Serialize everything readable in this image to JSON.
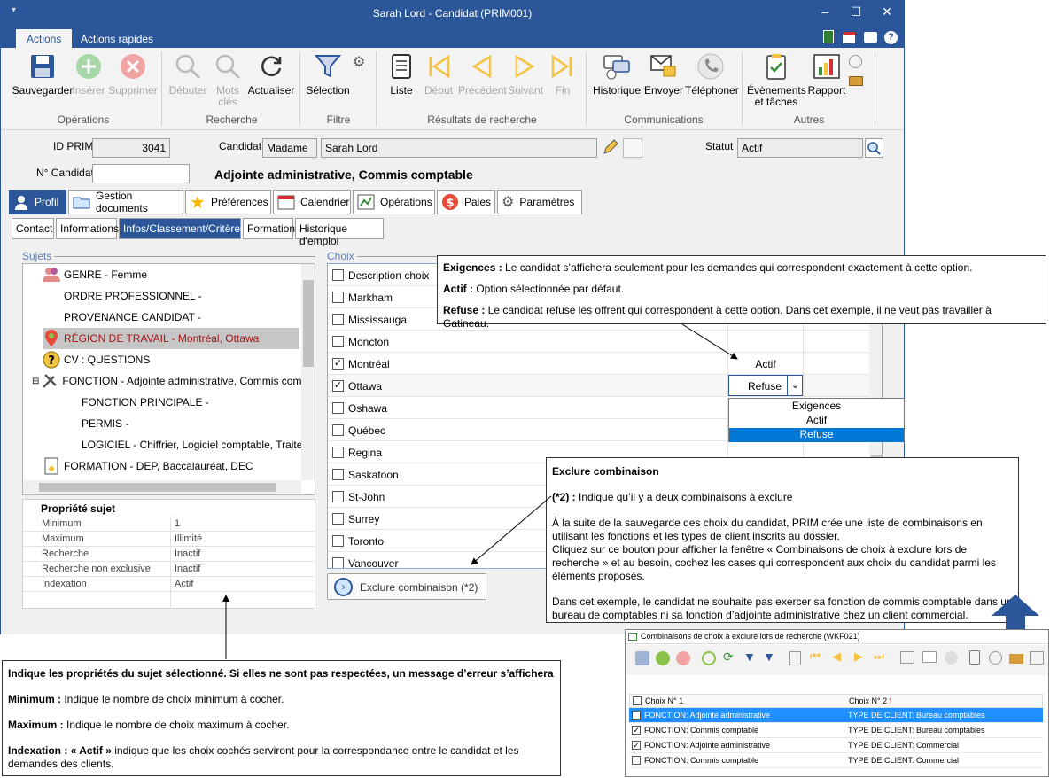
{
  "window": {
    "title": "Sarah Lord - Candidat (PRIM001)",
    "minimize": "–",
    "maximize": "☐",
    "close": "✕"
  },
  "ribbon_tabs": [
    "Actions",
    "Actions rapides"
  ],
  "ribbon": {
    "buttons": {
      "sauvegarder": "Sauvegarder",
      "inserer": "Insérer",
      "supprimer": "Supprimer",
      "debuter": "Débuter",
      "mots_cles": "Mots clés",
      "actualiser": "Actualiser",
      "selection": "Sélection",
      "liste": "Liste",
      "debut": "Début",
      "precedent": "Précédent",
      "suivant": "Suivant",
      "fin": "Fin",
      "historique": "Historique",
      "envoyer": "Envoyer",
      "telephoner": "Téléphoner",
      "evenements": "Évènements et tâches",
      "rapport": "Rapport"
    },
    "groups": [
      "Opérations",
      "Recherche",
      "Filtre",
      "Résultats de recherche",
      "Communications",
      "Autres"
    ]
  },
  "header": {
    "id_prim_label": "ID PRIM",
    "id_prim_value": "3041",
    "candidat_label": "Candidat",
    "civilite": "Madame",
    "nom": "Sarah Lord",
    "statut_label": "Statut",
    "statut_value": "Actif",
    "no_candidat_label": "N° Candidat",
    "no_candidat_value": "",
    "poste": "Adjointe administrative, Commis comptable"
  },
  "main_tabs": [
    "Profil",
    "Gestion documents",
    "Préférences",
    "Calendrier",
    "Opérations",
    "Paies",
    "Paramètres"
  ],
  "sub_tabs": [
    "Contact",
    "Informations",
    "Infos/Classement/Critères",
    "Formation",
    "Historique d'emploi"
  ],
  "sujets": {
    "legend": "Sujets",
    "items": [
      "GENRE - Femme",
      "ORDRE PROFESSIONNEL -",
      "PROVENANCE CANDIDAT -",
      "RÉGION DE TRAVAIL - Montréal, Ottawa",
      "CV : QUESTIONS",
      "FONCTION - Adjointe administrative, Commis comptable",
      "FONCTION PRINCIPALE -",
      "PERMIS -",
      "LOGICIEL - Chiffrier, Logiciel comptable, Traitement",
      "FORMATION - DEP, Baccalauréat, DEC"
    ]
  },
  "proprietes": {
    "title": "Propriété sujet",
    "rows": [
      {
        "k": "Minimum",
        "v": "1"
      },
      {
        "k": "Maximum",
        "v": "Illimité"
      },
      {
        "k": "Recherche",
        "v": "Inactif"
      },
      {
        "k": "Recherche non exclusive",
        "v": "Inactif"
      },
      {
        "k": "Indexation",
        "v": "Actif"
      }
    ]
  },
  "choix": {
    "legend": "Choix",
    "header": "Description choix",
    "rows": [
      {
        "label": "Markham",
        "checked": false,
        "status": ""
      },
      {
        "label": "Mississauga",
        "checked": false,
        "status": ""
      },
      {
        "label": "Moncton",
        "checked": false,
        "status": ""
      },
      {
        "label": "Montréal",
        "checked": true,
        "status": "Actif"
      },
      {
        "label": "Ottawa",
        "checked": true,
        "status": "Refuse"
      },
      {
        "label": "Oshawa",
        "checked": false,
        "status": ""
      },
      {
        "label": "Québec",
        "checked": false,
        "status": ""
      },
      {
        "label": "Regina",
        "checked": false,
        "status": ""
      },
      {
        "label": "Saskatoon",
        "checked": false,
        "status": ""
      },
      {
        "label": "St-John",
        "checked": false,
        "status": ""
      },
      {
        "label": "Surrey",
        "checked": false,
        "status": ""
      },
      {
        "label": "Toronto",
        "checked": false,
        "status": ""
      },
      {
        "label": "Vancouver",
        "checked": false,
        "status": ""
      }
    ],
    "dropdown_options": [
      "Exigences",
      "Actif",
      "Refuse"
    ],
    "dropdown_selected": "Refuse",
    "exclure_button": "Exclure combinaison (*2)"
  },
  "callouts": {
    "exigences": {
      "p1_bold": "Exigences :",
      "p1": " Le candidat s’affichera seulement pour les demandes qui correspondent exactement à cette option.",
      "p2_bold": "Actif :",
      "p2": " Option sélectionnée par défaut.",
      "p3_bold": "Refuse :",
      "p3": " Le candidat refuse les offrent qui correspondent à cette option. Dans cet exemple, il ne veut pas travailler à Gatineau."
    },
    "exclure": {
      "title": "Exclure combinaison",
      "p1_bold": "(*2) :",
      "p1": " Indique qu’il y a deux combinaisons à exclure",
      "p2": "À la suite de la sauvegarde des choix du candidat, PRIM crée une liste de combinaisons en utilisant les fonctions et les types de client inscrits au dossier.",
      "p3": "Cliquez sur ce bouton pour afficher la fenêtre « Combinaisons de choix à exclure lors de recherche » et au besoin, cochez les cases qui correspondent aux choix du candidat parmi les éléments proposés.",
      "p4": "Dans cet exemple, le candidat ne souhaite pas exercer sa fonction de commis comptable dans un bureau de comptables ni sa fonction d’adjointe administrative chez un client commercial."
    },
    "proprietes": {
      "title": "Indique les propriétés du sujet sélectionné. Si elles ne sont pas respectées, un message d’erreur s’affichera",
      "min_bold": "Minimum :",
      "min": " Indique le nombre de choix minimum à cocher.",
      "max_bold": "Maximum :",
      "max": " Indique le nombre de choix maximum à cocher.",
      "idx_bold": "Indexation : « Actif »",
      "idx": " indique que les choix cochés serviront pour la correspondance entre le candidat et les demandes des clients."
    }
  },
  "wkf021": {
    "title": "Combinaisons de choix à exclure lors de recherche (WKF021)",
    "col1": "Choix N° 1",
    "col2": "Choix N° 2",
    "rows": [
      {
        "c1": "FONCTION: Adjointe administrative",
        "c2": "TYPE DE CLIENT: Bureau comptables",
        "checked": false
      },
      {
        "c1": "FONCTION: Commis comptable",
        "c2": "TYPE DE CLIENT: Bureau comptables",
        "checked": true
      },
      {
        "c1": "FONCTION: Adjointe administrative",
        "c2": "TYPE DE CLIENT: Commercial",
        "checked": true
      },
      {
        "c1": "FONCTION: Commis comptable",
        "c2": "TYPE DE CLIENT: Commercial",
        "checked": false
      }
    ]
  },
  "colors": {
    "accent": "#2b579a",
    "selection": "#0078d7",
    "disabled": "#a6a6a6",
    "red_icon": "#e05050",
    "green_icon": "#4caf50"
  }
}
